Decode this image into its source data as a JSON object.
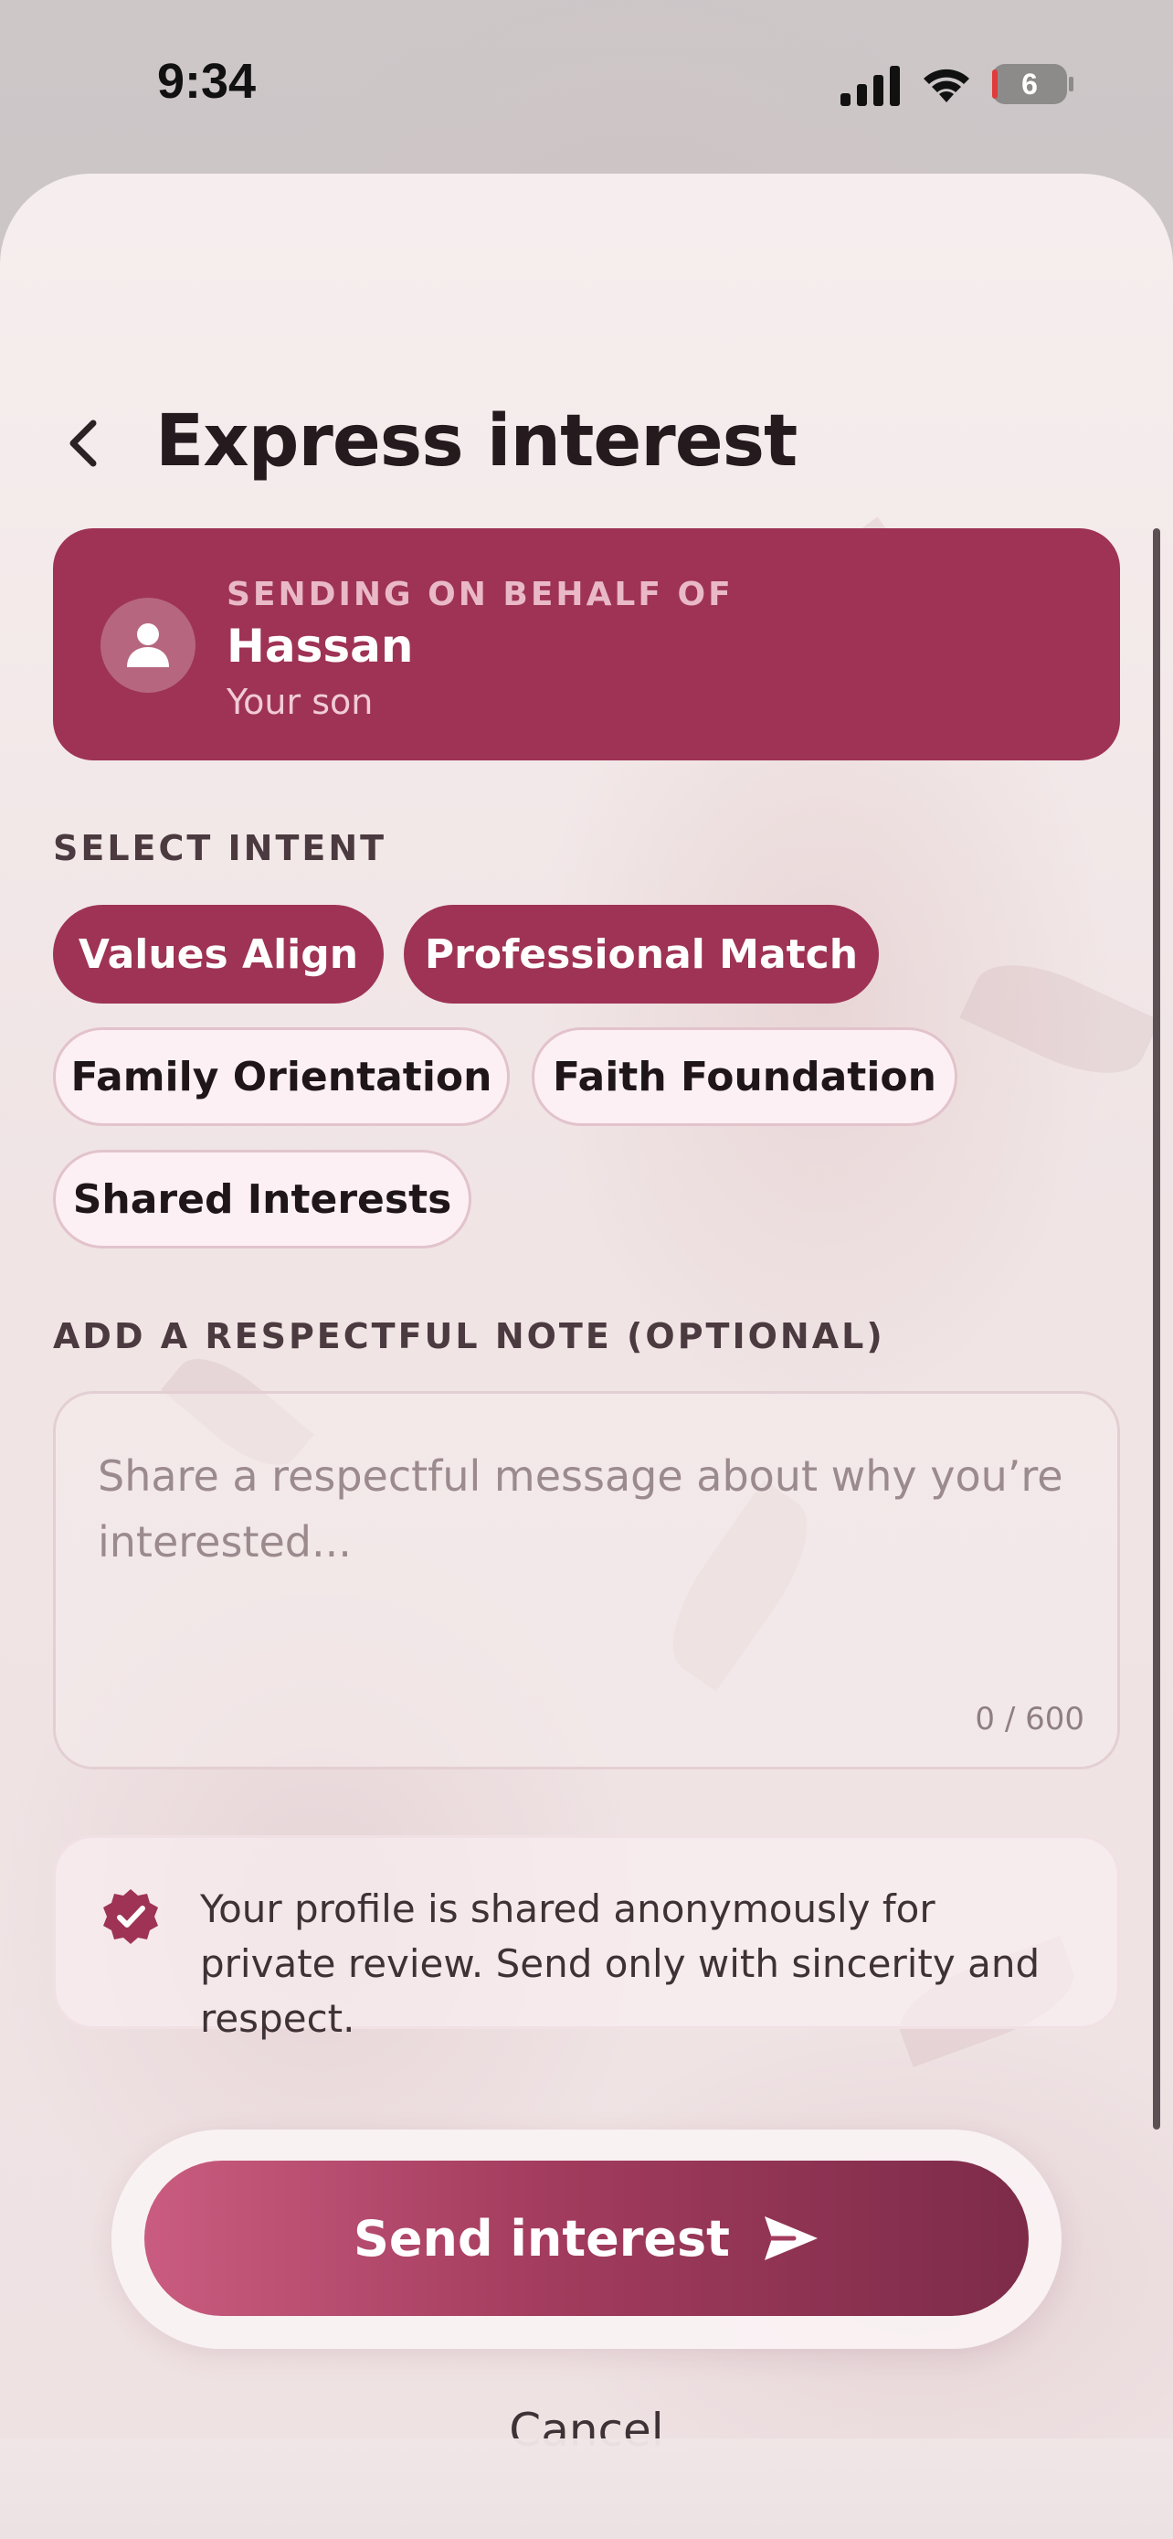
{
  "status_bar": {
    "time": "9:34",
    "battery": "6"
  },
  "header": {
    "title": "Express interest"
  },
  "behalf": {
    "label": "SENDING ON BEHALF OF",
    "name": "Hassan",
    "relation": "Your son"
  },
  "intent": {
    "label": "SELECT INTENT",
    "chips": [
      {
        "label": "Values Align",
        "selected": true
      },
      {
        "label": "Professional Match",
        "selected": true
      },
      {
        "label": "Family Orientation",
        "selected": false
      },
      {
        "label": "Faith Foundation",
        "selected": false
      },
      {
        "label": "Shared Interests",
        "selected": false
      }
    ]
  },
  "note": {
    "label": "ADD A RESPECTFUL NOTE (OPTIONAL)",
    "placeholder": "Share a respectful message about why you’re interested...",
    "count": "0 / 600"
  },
  "privacy": {
    "text": "Your profile is shared anonymously for private review. Send only with sincerity and respect."
  },
  "actions": {
    "send": "Send interest",
    "cancel": "Cancel"
  },
  "colors": {
    "accent": "#9e3355",
    "accent_light": "#fdf0f4",
    "text": "#251a1d"
  }
}
